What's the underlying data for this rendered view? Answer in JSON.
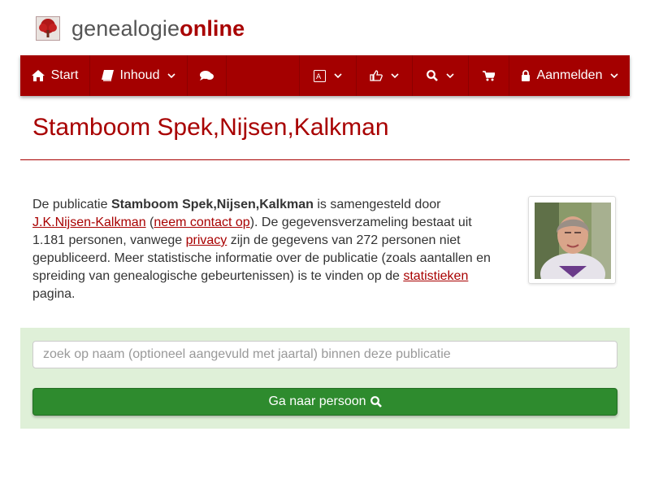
{
  "brand": {
    "text_plain": "genealogie",
    "text_accent": "online",
    "accent_color": "#a80000",
    "nav_color": "#a40000"
  },
  "nav": {
    "start_label": "Start",
    "inhoud_label": "Inhoud",
    "login_label": "Aanmelden"
  },
  "page": {
    "title": "Stamboom Spek,Nijsen,Kalkman"
  },
  "intro": {
    "t1": "De publicatie ",
    "pub_name": "Stamboom Spek,Nijsen,Kalkman",
    "t2": " is samengesteld door ",
    "author_link": "J.K.Nijsen-Kalkman",
    "t3": " (",
    "contact_link": "neem contact op",
    "t4": "). De gegevensverzameling bestaat uit 1.181 personen, vanwege ",
    "privacy_link": "privacy",
    "t5": " zijn de gegevens van 272 personen niet gepubliceerd. Meer statistische informatie over de publicatie (zoals aantallen en spreiding van genealogische gebeurtenissen) is te vinden op de ",
    "stats_link": "statistieken",
    "t6": " pagina."
  },
  "search": {
    "placeholder": "zoek op naam (optioneel aangevuld met jaartal) binnen deze publicatie",
    "value": "",
    "button_label": "Ga naar persoon",
    "panel_color": "#dff0d8",
    "button_color": "#2e8b2e"
  },
  "icons": [
    "tree-logo-icon",
    "home-icon",
    "book-icon",
    "comments-icon",
    "translate-icon",
    "thumbs-up-icon",
    "search-icon",
    "cart-icon",
    "lock-icon",
    "chevron-down-icon"
  ]
}
